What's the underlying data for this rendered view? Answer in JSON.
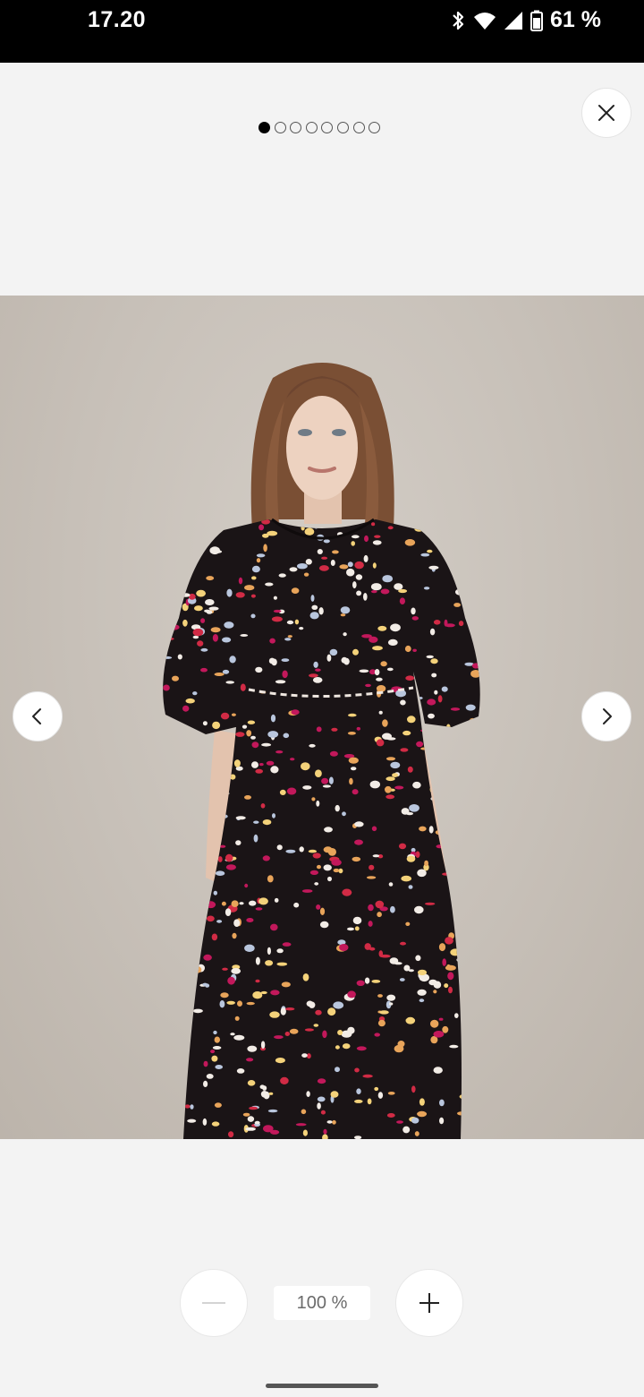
{
  "status_bar": {
    "time": "17.20",
    "battery_percent": "61 %",
    "icons": [
      "bluetooth-icon",
      "wifi-icon",
      "cellular-signal-icon",
      "battery-icon"
    ]
  },
  "viewer": {
    "close_icon": "close-icon",
    "pager": {
      "count": 8,
      "active_index": 0
    },
    "image_alt": "Model wearing a black floral print midi dress with puff sleeves",
    "prev_icon": "chevron-left-icon",
    "next_icon": "chevron-right-icon"
  },
  "zoom": {
    "level": "100 %",
    "out_icon": "minus-icon",
    "in_icon": "plus-icon"
  },
  "colors": {
    "background": "#f3f3f3",
    "status_bar": "#000000",
    "button": "#ffffff",
    "photo_backdrop": "#c7c0b8",
    "dress_base": "#1a1416",
    "print_red": "#d12b45",
    "print_white": "#f2ece6"
  }
}
